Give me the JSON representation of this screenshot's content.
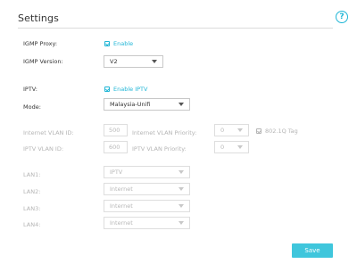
{
  "title": "Settings",
  "help_icon": "question-circle-icon",
  "igmp_proxy": {
    "label": "IGMP Proxy:",
    "enable_label": "Enable"
  },
  "igmp_version": {
    "label": "IGMP Version:",
    "value": "V2"
  },
  "iptv": {
    "label": "IPTV:",
    "enable_label": "Enable IPTV"
  },
  "mode": {
    "label": "Mode:",
    "value": "Malaysia-Unifi"
  },
  "internet_vlan_id": {
    "label": "Internet VLAN ID:",
    "value": "500"
  },
  "internet_vlan_priority": {
    "label": "Internet VLAN Priority:",
    "value": "0"
  },
  "tag_8021q": {
    "label": "802.1Q Tag"
  },
  "iptv_vlan_id": {
    "label": "IPTV VLAN ID:",
    "value": "600"
  },
  "iptv_vlan_priority": {
    "label": "IPTV VLAN Priority:",
    "value": "0"
  },
  "lan_ports": [
    {
      "label": "LAN1:",
      "value": "IPTV"
    },
    {
      "label": "LAN2:",
      "value": "Internet"
    },
    {
      "label": "LAN3:",
      "value": "Internet"
    },
    {
      "label": "LAN4:",
      "value": "Internet"
    }
  ],
  "save_label": "Save",
  "colors": {
    "accent": "#20b6d6",
    "save_button": "#3fc6dc",
    "disabled_text": "#b4b4b4"
  }
}
